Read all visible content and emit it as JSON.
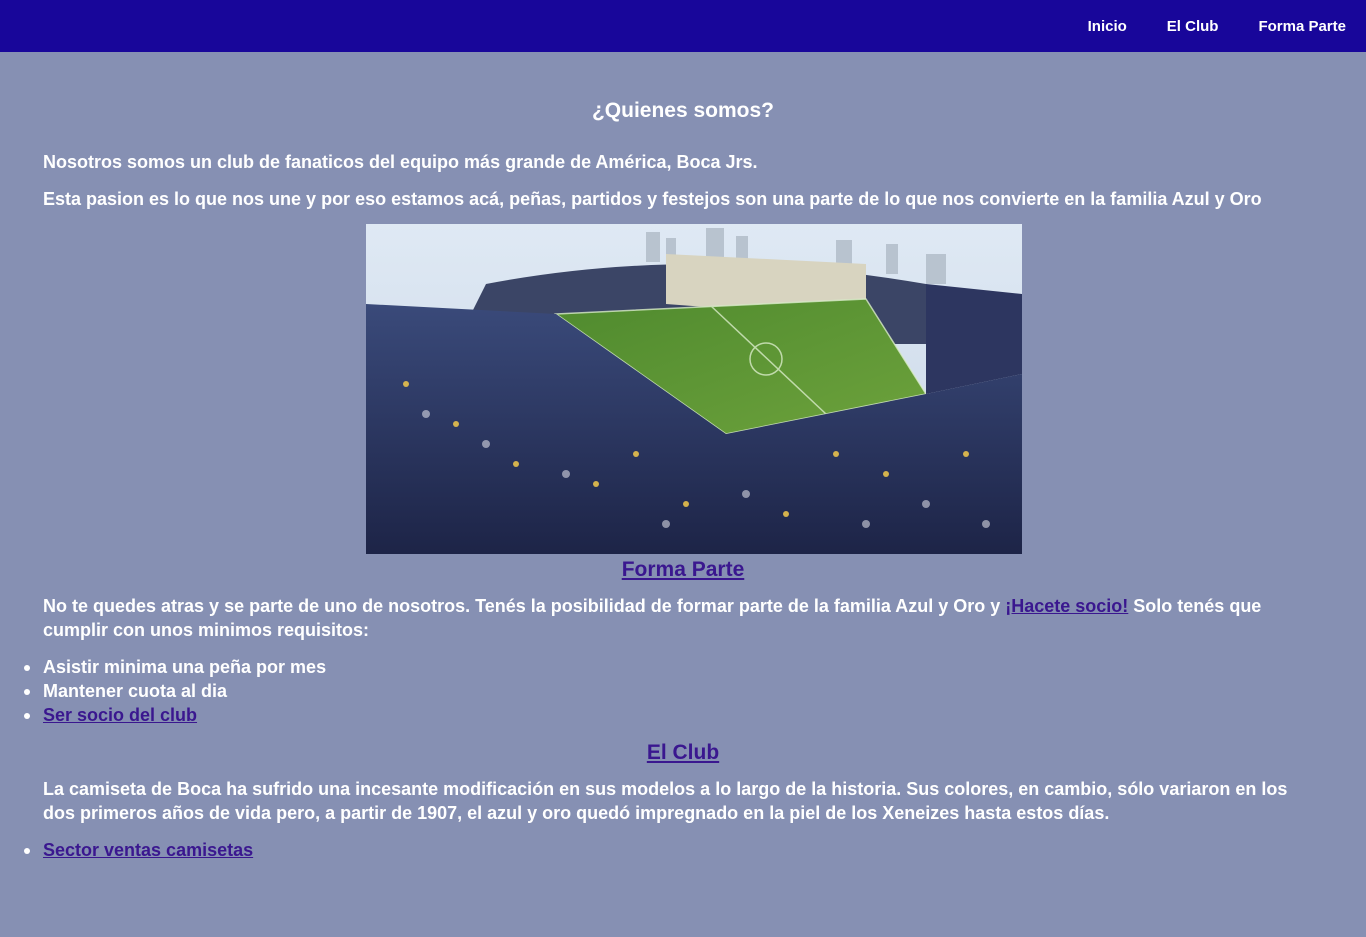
{
  "nav": {
    "items": [
      "Inicio",
      "El Club",
      "Forma Parte"
    ]
  },
  "about": {
    "title": "¿Quienes somos?",
    "p1": "Nosotros somos un club de fanaticos del equipo más grande de América, Boca Jrs.",
    "p2": "Esta pasion es lo que nos une y por eso estamos acá, peñas, partidos y festejos son una parte de lo que nos convierte en la familia Azul y Oro"
  },
  "join": {
    "heading_link": "Forma Parte",
    "text_before": "No te quedes atras y se parte de uno de nosotros. Tenés la posibilidad de formar parte de la familia Azul y Oro y ",
    "cta_link": "¡Hacete socio!",
    "text_after": " Solo tenés que cumplir con unos minimos requisitos:",
    "requirements": [
      "Asistir minima una peña por mes",
      "Mantener cuota al dia"
    ],
    "requirement_link": "Ser socio del club"
  },
  "club": {
    "heading_link": "El Club",
    "text": "La camiseta de Boca ha sufrido una incesante modificación en sus modelos a lo largo de la historia. Sus colores, en cambio, sólo variaron en los dos primeros años de vida pero, a partir de 1907, el azul y oro quedó impregnado en la piel de los Xeneizes hasta estos días.",
    "list_link": "Sector ventas camisetas"
  },
  "colors": {
    "navbar": "#18069a",
    "background": "#8690b3",
    "link": "#3a178f",
    "text": "#ffffff"
  }
}
